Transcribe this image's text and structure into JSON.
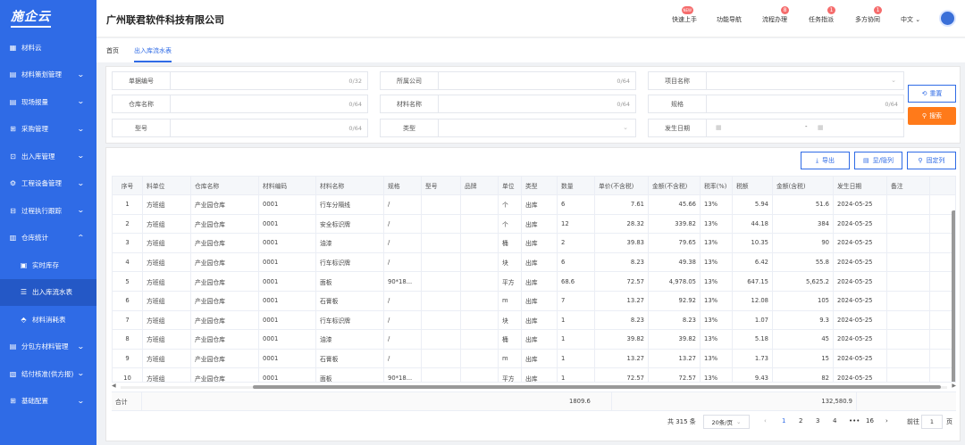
{
  "app": {
    "logo": "施企云",
    "company": "广州联君软件科技有限公司"
  },
  "sidebar": {
    "items": [
      {
        "label": "材料云",
        "icon": "grid-icon"
      },
      {
        "label": "材料策划管理",
        "icon": "doc-icon"
      },
      {
        "label": "现场报量",
        "icon": "doc-icon"
      },
      {
        "label": "采购管理",
        "icon": "cart-icon"
      },
      {
        "label": "出入库管理",
        "icon": "inbox-icon"
      },
      {
        "label": "工程设备管理",
        "icon": "gear-icon"
      },
      {
        "label": "过程执行跟踪",
        "icon": "track-icon"
      },
      {
        "label": "仓库统计",
        "icon": "chart-icon"
      },
      {
        "label": "实时库存",
        "icon": "stock-icon"
      },
      {
        "label": "出入库流水表",
        "icon": "list-icon"
      },
      {
        "label": "材料消耗表",
        "icon": "consume-icon"
      },
      {
        "label": "分包方材料管理",
        "icon": "doc-icon"
      },
      {
        "label": "结付核准(供方报)",
        "icon": "pay-icon"
      },
      {
        "label": "基础配置",
        "icon": "config-icon"
      }
    ]
  },
  "header": {
    "buttons": [
      {
        "label": "快速上手",
        "badge": "NEW"
      },
      {
        "label": "功能导航",
        "badge": ""
      },
      {
        "label": "流程办理",
        "badge": "8"
      },
      {
        "label": "任务指派",
        "badge": "1"
      },
      {
        "label": "多方协同",
        "badge": "1"
      }
    ],
    "lang": "中文"
  },
  "tabs": {
    "home": "首页",
    "current": "出入库流水表"
  },
  "filters": {
    "bill_no": {
      "label": "单据编号",
      "count": "0/32"
    },
    "company": {
      "label": "所属公司",
      "count": "0/64"
    },
    "project": {
      "label": "项目名称"
    },
    "warehouse": {
      "label": "仓库名称",
      "count": "0/64"
    },
    "material": {
      "label": "材料名称",
      "count": "0/64"
    },
    "spec": {
      "label": "规格",
      "count": "0/64"
    },
    "model": {
      "label": "型号",
      "count": "0/64"
    },
    "type": {
      "label": "类型"
    },
    "date": {
      "label": "发生日期",
      "sep": "-"
    },
    "reset": "重置",
    "search": "搜索"
  },
  "toolbar": {
    "export": "导出",
    "toggle_cols": "显/隐列",
    "fix_cols": "固定列"
  },
  "table": {
    "headers": [
      "序号",
      "料单位",
      "仓库名称",
      "材料编码",
      "材料名称",
      "规格",
      "型号",
      "品牌",
      "单位",
      "类型",
      "数量",
      "单价(不含税)",
      "金额(不含税)",
      "税率(%)",
      "税额",
      "金额(含税)",
      "发生日期",
      "备注"
    ],
    "rows": [
      [
        "1",
        "方班组",
        "产业园仓库",
        "0001",
        "行车分隔线",
        "/",
        "",
        "",
        "个",
        "出库",
        "6",
        "7.61",
        "45.66",
        "13%",
        "5.94",
        "51.6",
        "2024-05-25",
        ""
      ],
      [
        "2",
        "方班组",
        "产业园仓库",
        "0001",
        "安全标识牌",
        "/",
        "",
        "",
        "个",
        "出库",
        "12",
        "28.32",
        "339.82",
        "13%",
        "44.18",
        "384",
        "2024-05-25",
        ""
      ],
      [
        "3",
        "方班组",
        "产业园仓库",
        "0001",
        "油漆",
        "/",
        "",
        "",
        "桶",
        "出库",
        "2",
        "39.83",
        "79.65",
        "13%",
        "10.35",
        "90",
        "2024-05-25",
        ""
      ],
      [
        "4",
        "方班组",
        "产业园仓库",
        "0001",
        "行车标识牌",
        "/",
        "",
        "",
        "块",
        "出库",
        "6",
        "8.23",
        "49.38",
        "13%",
        "6.42",
        "55.8",
        "2024-05-25",
        ""
      ],
      [
        "5",
        "方班组",
        "产业园仓库",
        "0001",
        "面板",
        "90*18...",
        "",
        "",
        "平方",
        "出库",
        "68.6",
        "72.57",
        "4,978.05",
        "13%",
        "647.15",
        "5,625.2",
        "2024-05-25",
        ""
      ],
      [
        "6",
        "方班组",
        "产业园仓库",
        "0001",
        "石膏板",
        "/",
        "",
        "",
        "m",
        "出库",
        "7",
        "13.27",
        "92.92",
        "13%",
        "12.08",
        "105",
        "2024-05-25",
        ""
      ],
      [
        "7",
        "方班组",
        "产业园仓库",
        "0001",
        "行车标识牌",
        "/",
        "",
        "",
        "块",
        "出库",
        "1",
        "8.23",
        "8.23",
        "13%",
        "1.07",
        "9.3",
        "2024-05-25",
        ""
      ],
      [
        "8",
        "方班组",
        "产业园仓库",
        "0001",
        "油漆",
        "/",
        "",
        "",
        "桶",
        "出库",
        "1",
        "39.82",
        "39.82",
        "13%",
        "5.18",
        "45",
        "2024-05-25",
        ""
      ],
      [
        "9",
        "方班组",
        "产业园仓库",
        "0001",
        "石膏板",
        "/",
        "",
        "",
        "m",
        "出库",
        "1",
        "13.27",
        "13.27",
        "13%",
        "1.73",
        "15",
        "2024-05-25",
        ""
      ],
      [
        "10",
        "方班组",
        "产业园仓库",
        "0001",
        "面板",
        "90*18...",
        "",
        "",
        "平方",
        "出库",
        "1",
        "72.57",
        "72.57",
        "13%",
        "9.43",
        "82",
        "2024-05-25",
        ""
      ]
    ],
    "summary": {
      "label": "合计",
      "qty": "1809.6",
      "amount_tax": "132,580.9"
    }
  },
  "pager": {
    "total": "共 315 条",
    "size": "20条/页",
    "pages": [
      "1",
      "2",
      "3",
      "4",
      "•••",
      "16"
    ],
    "goto": "前往",
    "goto_value": "1",
    "page_unit": "页"
  }
}
